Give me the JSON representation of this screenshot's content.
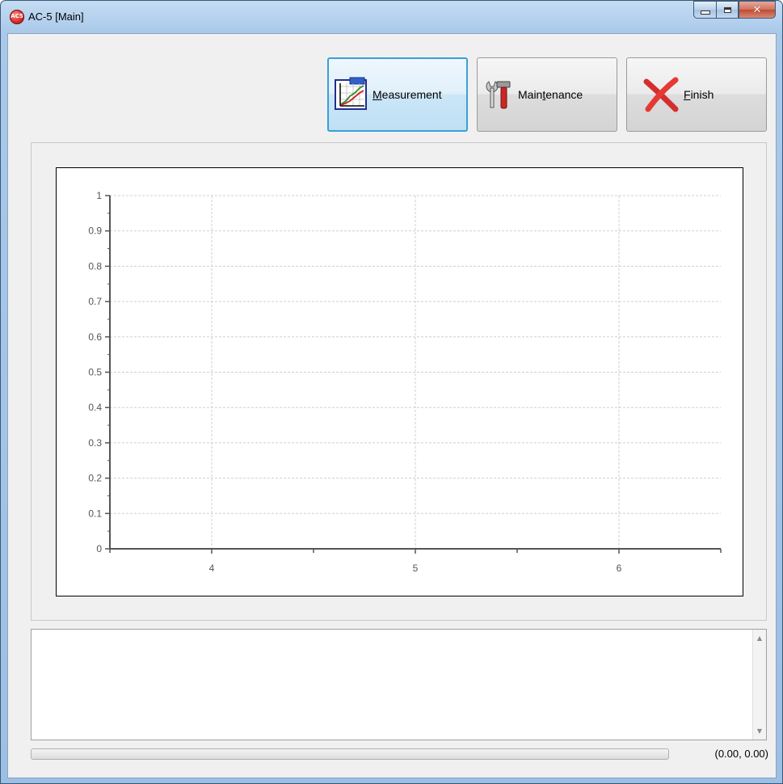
{
  "window": {
    "title": "AC-5 [Main]",
    "icon": "app-logo-icon",
    "icon_text": "AC5",
    "accent": "#3c9fd6"
  },
  "toolbar": {
    "buttons": [
      {
        "label": "Measurement",
        "mnemonic": "M",
        "icon": "chart-icon",
        "active": true
      },
      {
        "label": "Maintenance",
        "mnemonic": "t",
        "icon": "tools-icon",
        "active": false
      },
      {
        "label": "Finish",
        "mnemonic": "F",
        "icon": "close-x-icon",
        "active": false
      }
    ]
  },
  "chart_data": {
    "type": "line",
    "title": "",
    "xlabel": "",
    "ylabel": "",
    "series": [],
    "xlim": [
      3.5,
      6.5
    ],
    "ylim": [
      0,
      1
    ],
    "x_ticks": [
      "4",
      "5",
      "6"
    ],
    "y_ticks": [
      "0",
      "0.1",
      "0.2",
      "0.3",
      "0.4",
      "0.5",
      "0.6",
      "0.7",
      "0.8",
      "0.9",
      "1"
    ],
    "grid": true
  },
  "log": {
    "text": ""
  },
  "status": {
    "progress": 0,
    "coordinates": "(0.00, 0.00)"
  }
}
